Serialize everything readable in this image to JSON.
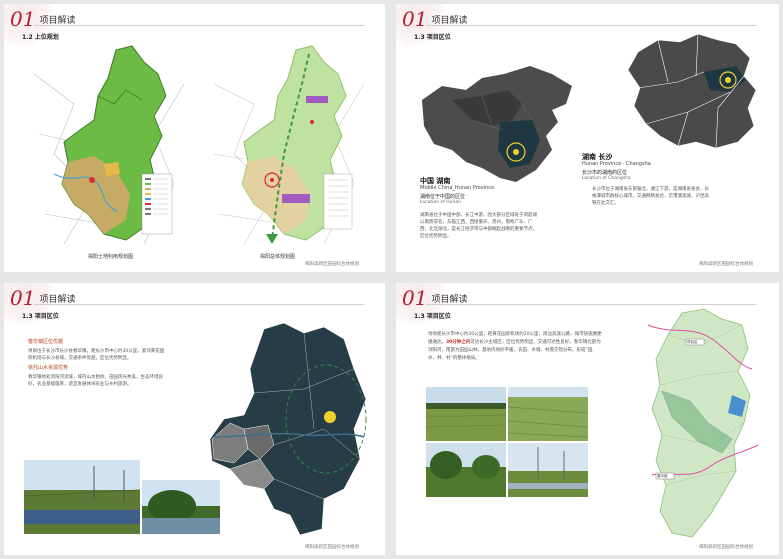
{
  "pages": [
    {
      "num": "01",
      "section": "项目解读",
      "sub": "1.2 上位规划",
      "captions": [
        "揭阳土地利用规划图",
        "揭阳总体规划图"
      ],
      "footer": "揭阳高新区田园综合体规划"
    },
    {
      "num": "01",
      "section": "项目解读",
      "sub": "1.3 项目区位",
      "china": {
        "title": "中国 湖南",
        "en": "Middle China_Hunan Province",
        "cn_sub": "湖南位于中国的区位",
        "en_sub": "Location of Hunan"
      },
      "hunan": {
        "title": "湖南 长沙",
        "en": "Hunan Province · Changsha",
        "cn_sub": "长沙市的湖南的区位",
        "en_sub": "Location of Changsha"
      },
      "para_left": "湖南省位于中国中部，长江中游，因大部分区域处于洞庭湖以南而得名，东临江西，西接重庆、贵州，南毗广东、广西，北连湖北，是长江经济带与中部崛起战略的重要节点，区位优势明显。",
      "para_right": "长沙市位于湖南省东部偏北，湘江下游，是湖南省省会，长株潭城市群核心城市，交通网络发达，京港澳高速、沪昆高铁在此交汇。",
      "footer": "揭阳高新区田园综合体规划"
    },
    {
      "num": "01",
      "section": "项目解读",
      "sub": "1.3 项目区位",
      "h1": "春华镇区位优越",
      "p1": "项目位于长沙市长沙县春华镇，距长沙市中心约30公里，紧邻黄花国际机场与长沙县城，交通条件优越，区位优势明显。",
      "h2": "依托山水资源优势",
      "p2": "春华镇地处浏阳河流域，域内山水相依，田园风光秀美，生态环境良好，农业基础雄厚，适宜发展休闲农业与乡村旅游。",
      "footer": "揭阳高新区田园综合体规划"
    },
    {
      "num": "01",
      "section": "项目解读",
      "sub": "1.3 项目区位",
      "para": "场地距长沙市中心约30公里，距黄花国际机场约20公里，周边高速公路、城市快速路便捷通达。",
      "highlight": "30分钟之内",
      "para_end": "可达长沙主城区，区位优势明显，交通可达性良好。春华镇北部为浏阳河，南部为田园山林，基地内地形平缓，农田、水塘、村落交错分布，形成“田、水、林、村”的整体格局。",
      "map_labels": [
        "项目区",
        "春华镇"
      ],
      "footer": "揭阳高新区田园综合体规划"
    }
  ]
}
